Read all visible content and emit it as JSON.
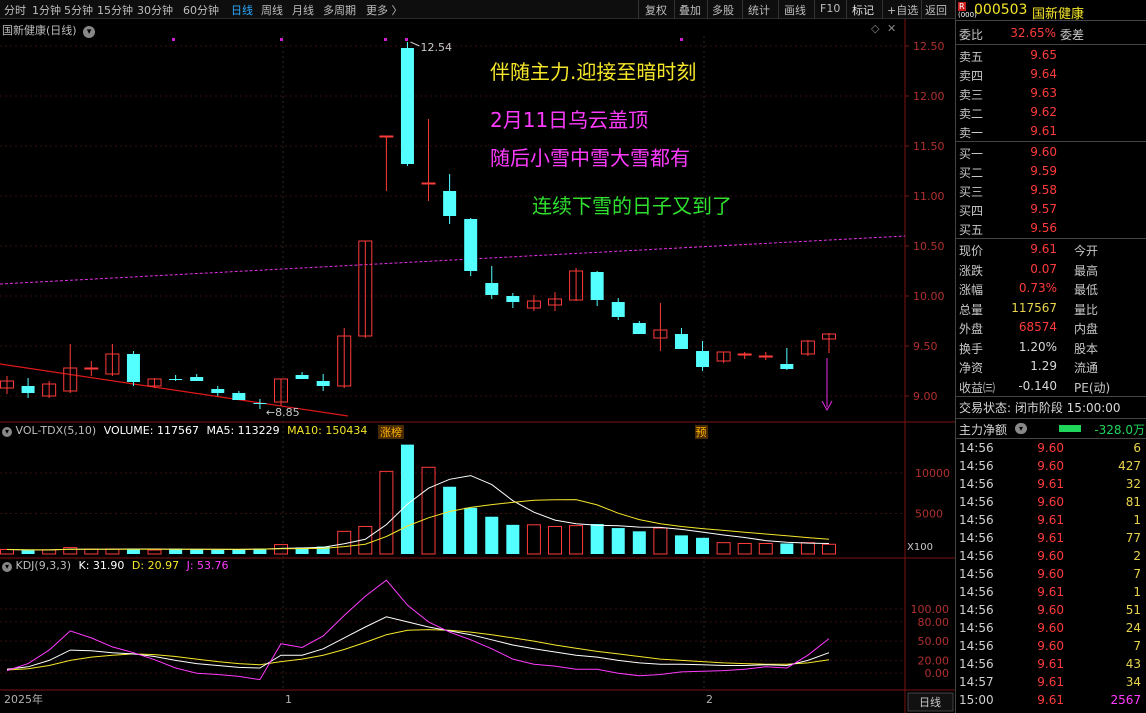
{
  "toolbar": {
    "periods": [
      "分时",
      "1分钟",
      "5分钟",
      "15分钟",
      "30分钟",
      "60分钟",
      "日线",
      "周线",
      "月线",
      "多周期",
      "更多 〉"
    ],
    "active_period": "日线",
    "tools": [
      "复权",
      "叠加",
      "多股",
      "统计",
      "画线",
      "F10",
      "+自选",
      "返回"
    ]
  },
  "chart": {
    "title": "国新健康(日线)",
    "yaxis_ticks": [
      "12.50",
      "12.00",
      "11.50",
      "11.00",
      "10.50",
      "10.00",
      "9.50",
      "9.00"
    ],
    "high_label": "12.54",
    "low_label": "8.85",
    "annotations": [
      {
        "text": "伴随主力.迎接至暗时刻",
        "color": "#f5e62a"
      },
      {
        "text": "2月11日乌云盖顶",
        "color": "#ff3bff"
      },
      {
        "text": "随后小雪中雪大雪都有",
        "color": "#ff3bff"
      },
      {
        "text": "连续下雪的日子又到了",
        "color": "#2fe02f"
      }
    ],
    "badges": [
      "涨榜",
      "预"
    ],
    "volume_title": "VOL-TDX(5,10)",
    "volume_stats": [
      {
        "text": "VOLUME: 117567",
        "color": "#ffffff"
      },
      {
        "text": "MA5: 113229",
        "color": "#ffffff"
      },
      {
        "text": "MA10: 150434",
        "color": "#f5e62a"
      }
    ],
    "volume_ticks": [
      "10000",
      "5000"
    ],
    "volume_unit": "X100",
    "kdj_title": "KDJ(9,3,3)",
    "kdj_stats": [
      {
        "text": "K: 31.90",
        "color": "#ffffff"
      },
      {
        "text": "D: 20.97",
        "color": "#f5e62a"
      },
      {
        "text": "J: 53.76",
        "color": "#ff3bff"
      }
    ],
    "kdj_ticks": [
      "100.00",
      "80.00",
      "50.00",
      "20.00",
      "0.00"
    ],
    "xaxis_labels": [
      "2025年",
      "1",
      "2"
    ],
    "footer_period": "日线"
  },
  "chart_data": {
    "type": "candlestick",
    "note": "daily OHLC, approximate values read from price axis",
    "candles": [
      {
        "o": 9.08,
        "h": 9.2,
        "l": 9.02,
        "c": 9.15
      },
      {
        "o": 9.1,
        "h": 9.18,
        "l": 8.98,
        "c": 9.03
      },
      {
        "o": 9.0,
        "h": 9.15,
        "l": 8.98,
        "c": 9.12
      },
      {
        "o": 9.05,
        "h": 9.52,
        "l": 9.03,
        "c": 9.28
      },
      {
        "o": 9.27,
        "h": 9.35,
        "l": 9.2,
        "c": 9.28
      },
      {
        "o": 9.22,
        "h": 9.52,
        "l": 9.2,
        "c": 9.42
      },
      {
        "o": 9.42,
        "h": 9.45,
        "l": 9.1,
        "c": 9.14
      },
      {
        "o": 9.1,
        "h": 9.18,
        "l": 9.08,
        "c": 9.17
      },
      {
        "o": 9.17,
        "h": 9.21,
        "l": 9.15,
        "c": 9.16
      },
      {
        "o": 9.19,
        "h": 9.22,
        "l": 9.15,
        "c": 9.15
      },
      {
        "o": 9.07,
        "h": 9.1,
        "l": 9.0,
        "c": 9.03
      },
      {
        "o": 9.03,
        "h": 9.05,
        "l": 8.97,
        "c": 8.96
      },
      {
        "o": 8.93,
        "h": 8.97,
        "l": 8.87,
        "c": 8.92
      },
      {
        "o": 8.94,
        "h": 9.17,
        "l": 8.9,
        "c": 9.17
      },
      {
        "o": 9.21,
        "h": 9.24,
        "l": 9.18,
        "c": 9.17
      },
      {
        "o": 9.15,
        "h": 9.22,
        "l": 9.05,
        "c": 9.1
      },
      {
        "o": 9.1,
        "h": 9.68,
        "l": 9.08,
        "c": 9.6
      },
      {
        "o": 9.6,
        "h": 10.55,
        "l": 9.58,
        "c": 10.55
      },
      {
        "o": 11.6,
        "h": 11.6,
        "l": 11.05,
        "c": 11.6
      },
      {
        "o": 12.48,
        "h": 12.54,
        "l": 11.3,
        "c": 11.32
      },
      {
        "o": 11.13,
        "h": 11.77,
        "l": 10.95,
        "c": 11.13
      },
      {
        "o": 11.05,
        "h": 11.22,
        "l": 10.72,
        "c": 10.8
      },
      {
        "o": 10.77,
        "h": 10.78,
        "l": 10.2,
        "c": 10.25
      },
      {
        "o": 10.13,
        "h": 10.3,
        "l": 9.97,
        "c": 10.01
      },
      {
        "o": 10.0,
        "h": 10.03,
        "l": 9.88,
        "c": 9.94
      },
      {
        "o": 9.88,
        "h": 10.01,
        "l": 9.85,
        "c": 9.95
      },
      {
        "o": 9.91,
        "h": 10.04,
        "l": 9.85,
        "c": 9.97
      },
      {
        "o": 9.96,
        "h": 10.28,
        "l": 9.95,
        "c": 10.25
      },
      {
        "o": 10.24,
        "h": 10.25,
        "l": 9.9,
        "c": 9.96
      },
      {
        "o": 9.94,
        "h": 9.98,
        "l": 9.76,
        "c": 9.79
      },
      {
        "o": 9.73,
        "h": 9.75,
        "l": 9.62,
        "c": 9.62
      },
      {
        "o": 9.58,
        "h": 9.93,
        "l": 9.45,
        "c": 9.66
      },
      {
        "o": 9.62,
        "h": 9.68,
        "l": 9.48,
        "c": 9.47
      },
      {
        "o": 9.45,
        "h": 9.55,
        "l": 9.25,
        "c": 9.29
      },
      {
        "o": 9.35,
        "h": 9.44,
        "l": 9.33,
        "c": 9.44
      },
      {
        "o": 9.41,
        "h": 9.44,
        "l": 9.37,
        "c": 9.42
      },
      {
        "o": 9.4,
        "h": 9.44,
        "l": 9.36,
        "c": 9.4
      },
      {
        "o": 9.32,
        "h": 9.48,
        "l": 9.26,
        "c": 9.27
      },
      {
        "o": 9.42,
        "h": 9.56,
        "l": 9.4,
        "c": 9.55
      },
      {
        "o": 9.57,
        "h": 9.63,
        "l": 9.43,
        "c": 9.62
      }
    ],
    "volume": [
      560,
      450,
      510,
      790,
      580,
      620,
      600,
      490,
      660,
      580,
      500,
      560,
      680,
      1160,
      810,
      920,
      2800,
      3400,
      10200,
      13500,
      10700,
      8300,
      5700,
      4600,
      3600,
      3600,
      3400,
      3500,
      3700,
      3200,
      2800,
      3200,
      2300,
      2000,
      1400,
      1300,
      1300,
      1300,
      1400,
      1200
    ],
    "k_series": [
      6,
      10,
      20,
      36,
      35,
      32,
      30,
      26,
      20,
      15,
      12,
      9,
      8,
      28,
      28,
      38,
      55,
      72,
      88,
      80,
      72,
      66,
      60,
      52,
      44,
      38,
      33,
      28,
      25,
      20,
      16,
      14,
      14,
      13,
      12,
      12,
      13,
      12,
      20,
      32
    ],
    "d_series": [
      5,
      7,
      12,
      20,
      25,
      28,
      30,
      29,
      26,
      22,
      18,
      15,
      13,
      18,
      22,
      28,
      37,
      48,
      60,
      67,
      68,
      67,
      64,
      60,
      55,
      50,
      44,
      39,
      34,
      30,
      26,
      22,
      20,
      18,
      16,
      15,
      14,
      14,
      16,
      21
    ],
    "j_series": [
      4,
      15,
      36,
      66,
      55,
      41,
      32,
      21,
      8,
      0,
      -2,
      -5,
      -10,
      46,
      40,
      58,
      90,
      120,
      145,
      106,
      80,
      64,
      52,
      38,
      22,
      14,
      11,
      6,
      6,
      0,
      -4,
      -2,
      2,
      3,
      4,
      6,
      10,
      8,
      28,
      54
    ],
    "ma_line": {
      "start": 10.12,
      "end": 10.6
    },
    "trend_line": {
      "start": 9.32,
      "end": 8.8
    }
  },
  "right_panel": {
    "code_badge": "R",
    "code": "000503",
    "name": "国新健康",
    "weibi_label": "委比",
    "weibi_value": "32.65%",
    "weicha_label": "委差",
    "asks": [
      {
        "label": "卖五",
        "price": "9.65"
      },
      {
        "label": "卖四",
        "price": "9.64"
      },
      {
        "label": "卖三",
        "price": "9.63"
      },
      {
        "label": "卖二",
        "price": "9.62"
      },
      {
        "label": "卖一",
        "price": "9.61"
      }
    ],
    "bids": [
      {
        "label": "买一",
        "price": "9.60"
      },
      {
        "label": "买二",
        "price": "9.59"
      },
      {
        "label": "买三",
        "price": "9.58"
      },
      {
        "label": "买四",
        "price": "9.57"
      },
      {
        "label": "买五",
        "price": "9.56"
      }
    ],
    "stats": [
      {
        "label": "现价",
        "value": "9.61",
        "color": "#ff3b3b",
        "label2": "今开"
      },
      {
        "label": "涨跌",
        "value": "0.07",
        "color": "#ff3b3b",
        "label2": "最高"
      },
      {
        "label": "涨幅",
        "value": "0.73%",
        "color": "#ff3b3b",
        "label2": "最低"
      },
      {
        "label": "总量",
        "value": "117567",
        "color": "#e8d44d",
        "label2": "量比"
      },
      {
        "label": "外盘",
        "value": "68574",
        "color": "#ff3b3b",
        "label2": "内盘"
      },
      {
        "label": "换手",
        "value": "1.20%",
        "color": "#d8d8d8",
        "label2": "股本"
      },
      {
        "label": "净资",
        "value": "1.29",
        "color": "#d8d8d8",
        "label2": "流通"
      },
      {
        "label": "收益㈢",
        "value": "-0.140",
        "color": "#d8d8d8",
        "label2": "PE(动)"
      }
    ],
    "status": "交易状态: 闭市阶段 15:00:00",
    "net_flow_label": "主力净额",
    "net_flow_value": "-328.0万",
    "ticks": [
      {
        "time": "14:56",
        "price": "9.60",
        "vol": "6",
        "pc": "#ff3b3b",
        "vc": "#e8d44d"
      },
      {
        "time": "14:56",
        "price": "9.60",
        "vol": "427",
        "pc": "#ff3b3b",
        "vc": "#e8d44d"
      },
      {
        "time": "14:56",
        "price": "9.61",
        "vol": "32",
        "pc": "#ff3b3b",
        "vc": "#e8d44d"
      },
      {
        "time": "14:56",
        "price": "9.60",
        "vol": "81",
        "pc": "#ff3b3b",
        "vc": "#e8d44d"
      },
      {
        "time": "14:56",
        "price": "9.61",
        "vol": "1",
        "pc": "#ff3b3b",
        "vc": "#e8d44d"
      },
      {
        "time": "14:56",
        "price": "9.61",
        "vol": "77",
        "pc": "#ff3b3b",
        "vc": "#e8d44d"
      },
      {
        "time": "14:56",
        "price": "9.60",
        "vol": "2",
        "pc": "#ff3b3b",
        "vc": "#e8d44d"
      },
      {
        "time": "14:56",
        "price": "9.60",
        "vol": "7",
        "pc": "#ff3b3b",
        "vc": "#e8d44d"
      },
      {
        "time": "14:56",
        "price": "9.61",
        "vol": "1",
        "pc": "#ff3b3b",
        "vc": "#e8d44d"
      },
      {
        "time": "14:56",
        "price": "9.60",
        "vol": "51",
        "pc": "#ff3b3b",
        "vc": "#e8d44d"
      },
      {
        "time": "14:56",
        "price": "9.60",
        "vol": "24",
        "pc": "#ff3b3b",
        "vc": "#e8d44d"
      },
      {
        "time": "14:56",
        "price": "9.60",
        "vol": "7",
        "pc": "#ff3b3b",
        "vc": "#e8d44d"
      },
      {
        "time": "14:56",
        "price": "9.61",
        "vol": "43",
        "pc": "#ff3b3b",
        "vc": "#e8d44d"
      },
      {
        "time": "14:57",
        "price": "9.61",
        "vol": "34",
        "pc": "#ff3b3b",
        "vc": "#e8d44d"
      },
      {
        "time": "15:00",
        "price": "9.61",
        "vol": "2567",
        "pc": "#ff3b3b",
        "vc": "#ff3bff"
      }
    ]
  },
  "colors": {
    "up": "#ff3b3b",
    "down": "#54ffff",
    "ma": "#e62ee6",
    "trend": "#e01818",
    "k": "#ffffff",
    "d": "#f5e62a",
    "j": "#ff3bff"
  }
}
